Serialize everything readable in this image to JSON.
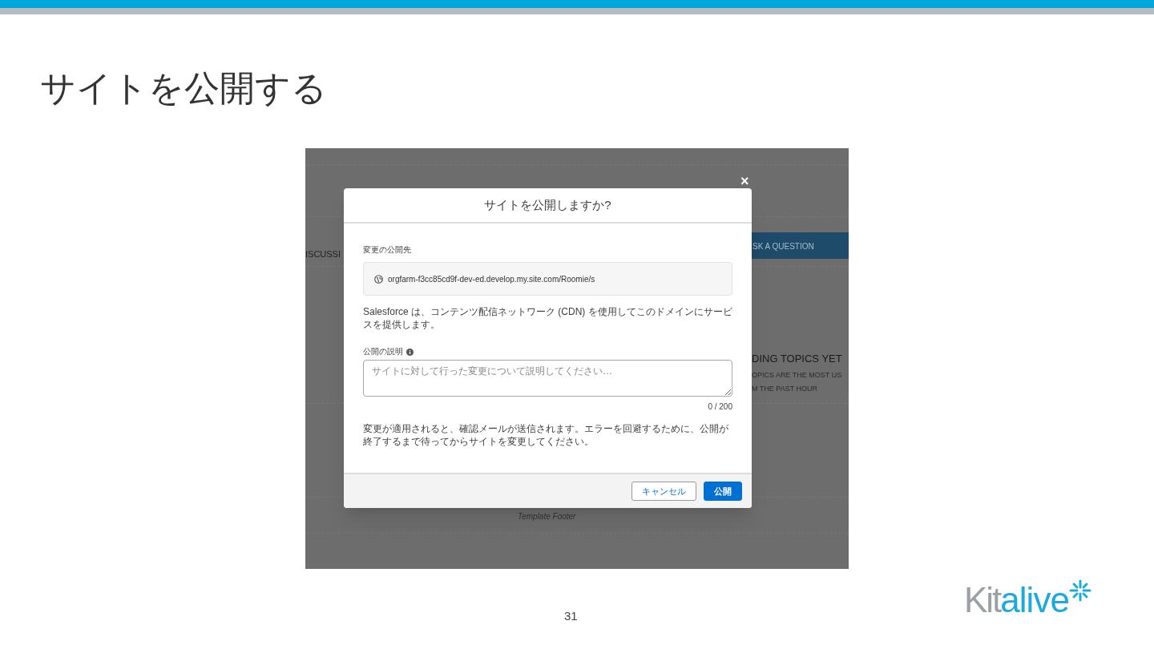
{
  "slide": {
    "title": "サイトを公開する",
    "page_number": "31"
  },
  "logo": {
    "part_1": "Kit",
    "part_2": "alive"
  },
  "background_page": {
    "tab": "ISCUSSI",
    "ask_button": "SK A QUESTION",
    "topics_title": "DING TOPICS YET",
    "topics_lines": [
      "OPICS ARE THE MOST US",
      "M THE PAST HOUR"
    ],
    "footer": "Template Footer"
  },
  "dialog": {
    "title": "サイトを公開しますか?",
    "close": "×",
    "destination_label": "変更の公開先",
    "url": "orgfarm-f3cc85cd9f-dev-ed.develop.my.site.com/Roomie/s",
    "cdn_note": "Salesforce は、コンテンツ配信ネットワーク (CDN) を使用してこのドメインにサービスを提供します。",
    "description_label": "公開の説明",
    "description": {
      "placeholder": "サイトに対して行った変更について説明してください…",
      "counter": "0 / 200"
    },
    "email_note": "変更が適用されると、確認メールが送信されます。エラーを回避するために、公開が終了するまで待ってからサイトを変更してください。",
    "buttons": [
      {
        "label": "キャンセル",
        "kind": "neutral"
      },
      {
        "label": "公開",
        "kind": "brand"
      }
    ]
  }
}
